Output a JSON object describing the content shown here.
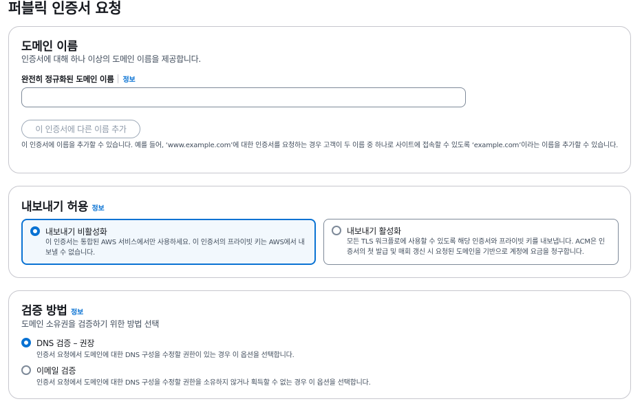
{
  "page": {
    "title": "퍼블릭 인증서 요청"
  },
  "domain_panel": {
    "heading": "도메인 이름",
    "description": "인증서에 대해 하나 이상의 도메인 이름을 제공합니다.",
    "field_label": "완전히 정규화된 도메인 이름",
    "info_label": "정보",
    "input_value": "",
    "add_button_label": "이 인증서에 다른 이름 추가",
    "help_text": "이 인증서에 이름을 추가할 수 있습니다. 예를 들어, ‘www.example.com’에 대한 인증서를 요청하는 경우 고객이 두 이름 중 하나로 사이트에 접속할 수 있도록 ‘example.com’이라는 이름을 추가할 수 있습니다."
  },
  "export_panel": {
    "heading": "내보내기 허용",
    "info_label": "정보",
    "options": [
      {
        "title": "내보내기 비활성화",
        "description": "이 인증서는 통합된 AWS 서비스에서만 사용하세요. 이 인증서의 프라이빗 키는 AWS에서 내보낼 수 없습니다.",
        "selected": true
      },
      {
        "title": "내보내기 활성화",
        "description": "모든 TLS 워크플로에 사용할 수 있도록 해당 인증서와 프라이빗 키를 내보냅니다. ACM은 인증서의 첫 발급 및 매회 갱신 시 요청된 도메인을 기반으로 계정에 요금을 청구합니다.",
        "selected": false
      }
    ]
  },
  "validation_panel": {
    "heading": "검증 방법",
    "info_label": "정보",
    "description": "도메인 소유권을 검증하기 위한 방법 선택",
    "options": [
      {
        "title": "DNS 검증 – 권장",
        "description": "인증서 요청에서 도메인에 대한 DNS 구성을 수정할 권한이 있는 경우 이 옵션을 선택합니다.",
        "selected": true
      },
      {
        "title": "이메일 검증",
        "description": "인증서 요청에서 도메인에 대한 DNS 구성을 수정할 권한을 소유하지 않거나 획득할 수 없는 경우 이 옵션을 선택합니다.",
        "selected": false
      }
    ]
  },
  "colors": {
    "accent": "#0972d3",
    "border": "#c6c6cd",
    "text": "#16191f",
    "muted": "#414d5c"
  }
}
